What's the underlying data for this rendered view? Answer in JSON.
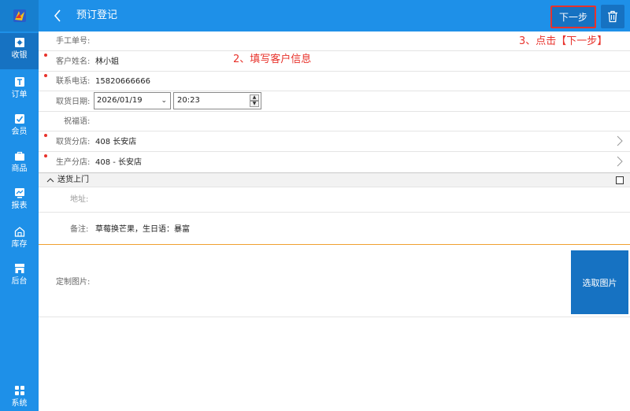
{
  "colors": {
    "brand": "#1e90e8",
    "brand_dark": "#1672c2",
    "annotation": "#e8322b",
    "divider_orange": "#f0a030"
  },
  "sidebar": {
    "logo": "app-logo",
    "items": [
      {
        "label": "收银",
        "icon": "cashier-icon",
        "active": true
      },
      {
        "label": "订单",
        "icon": "order-icon"
      },
      {
        "label": "会员",
        "icon": "member-icon"
      },
      {
        "label": "商品",
        "icon": "product-icon"
      },
      {
        "label": "报表",
        "icon": "report-icon"
      },
      {
        "label": "库存",
        "icon": "inventory-icon"
      },
      {
        "label": "后台",
        "icon": "backend-icon"
      },
      {
        "label": "系统",
        "icon": "system-icon"
      }
    ]
  },
  "header": {
    "title": "预订登记",
    "next_label": "下一步"
  },
  "form": {
    "manual_no_label": "手工单号:",
    "customer_name_label": "客户姓名:",
    "customer_name_value": "林小姐",
    "phone_label": "联系电话:",
    "phone_value": "15820666666",
    "pickup_date_label": "取货日期:",
    "pickup_date_value": "2026/01/19",
    "pickup_time_value": "20:23",
    "greeting_label": "祝福语:",
    "pickup_store_label": "取货分店:",
    "pickup_store_value": "408 长安店",
    "production_store_label": "生产分店:",
    "production_store_value": "408 - 长安店",
    "delivery_label": "送货上门",
    "address_label": "地址:",
    "remark_label": "备注:",
    "remark_value": "草莓换芒果，生日语：暴富",
    "custom_image_label": "定制图片:",
    "pick_image_label": "选取图片"
  },
  "annotations": {
    "step2": "2、填写客户信息",
    "step3": "3、点击【下一步】"
  }
}
